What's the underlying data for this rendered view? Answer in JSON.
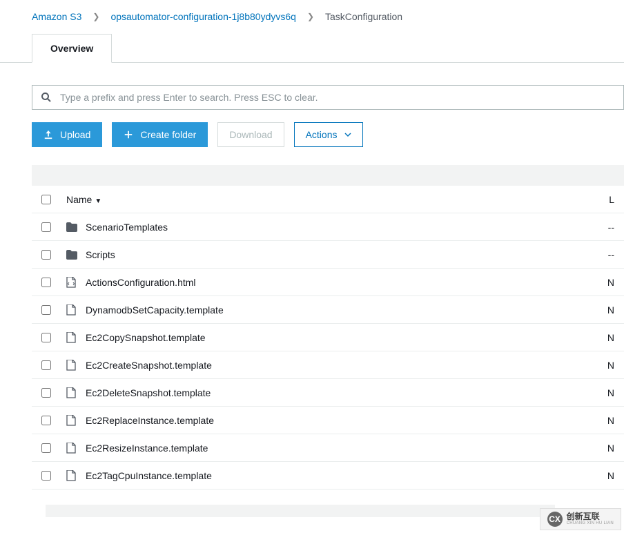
{
  "breadcrumbs": {
    "root": "Amazon S3",
    "bucket": "opsautomator-configuration-1j8b80ydyvs6q",
    "folder": "TaskConfiguration"
  },
  "tabs": {
    "overview": "Overview"
  },
  "search": {
    "placeholder": "Type a prefix and press Enter to search. Press ESC to clear."
  },
  "toolbar": {
    "upload_label": "Upload",
    "create_folder_label": "Create folder",
    "download_label": "Download",
    "actions_label": "Actions"
  },
  "columns": {
    "name": "Name",
    "last": "L"
  },
  "items": [
    {
      "type": "folder",
      "name": "ScenarioTemplates",
      "last": "--"
    },
    {
      "type": "folder",
      "name": "Scripts",
      "last": "--"
    },
    {
      "type": "html",
      "name": "ActionsConfiguration.html",
      "last": "N"
    },
    {
      "type": "file",
      "name": "DynamodbSetCapacity.template",
      "last": "N"
    },
    {
      "type": "file",
      "name": "Ec2CopySnapshot.template",
      "last": "N"
    },
    {
      "type": "file",
      "name": "Ec2CreateSnapshot.template",
      "last": "N"
    },
    {
      "type": "file",
      "name": "Ec2DeleteSnapshot.template",
      "last": "N"
    },
    {
      "type": "file",
      "name": "Ec2ReplaceInstance.template",
      "last": "N"
    },
    {
      "type": "file",
      "name": "Ec2ResizeInstance.template",
      "last": "N"
    },
    {
      "type": "file",
      "name": "Ec2TagCpuInstance.template",
      "last": "N"
    }
  ],
  "watermark": {
    "ch": "创新互联",
    "en": "CHUANG XIN HU LIAN"
  }
}
